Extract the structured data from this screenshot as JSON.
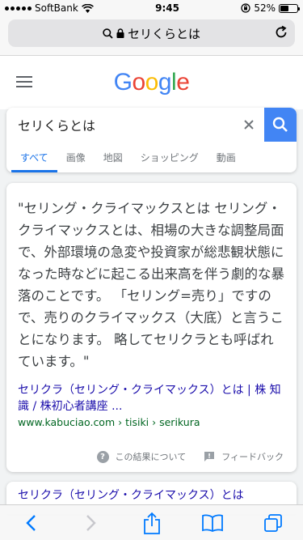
{
  "status": {
    "carrier": "SoftBank",
    "time": "9:45",
    "battery": "52%",
    "battery_level": 0.52
  },
  "urlbar": {
    "text": "セリくらとは"
  },
  "google": {
    "logo": [
      "G",
      "o",
      "o",
      "g",
      "l",
      "e"
    ],
    "logo_colors": [
      "#4285F4",
      "#EA4335",
      "#FBBC05",
      "#4285F4",
      "#34A853",
      "#EA4335"
    ]
  },
  "search": {
    "query": "セリくらとは",
    "tabs": [
      "すべて",
      "画像",
      "地図",
      "ショッピング",
      "動画"
    ]
  },
  "result": {
    "snippet": "\"セリング・クライマックスとは セリング・クライマックスとは、相場の大きな調整局面で、外部環境の急変や投資家が総悲観状態になった時などに起こる出来高を伴う劇的な暴落のことです。 「セリング=売り」ですので、売りのクライマックス（大底）と言うことになります。 略してセリクラとも呼ばれています。\"",
    "title": "セリクラ（セリング・クライマックス）とは | 株 知識 / 株初心者講座 ...",
    "url": "www.kabuciao.com › tisiki › serikura",
    "about": "この結果について",
    "feedback": "フィードバック"
  },
  "result2": {
    "title": "セリクラ（セリング・クライマックス）とは"
  },
  "colors": {
    "link": "#1a0dab",
    "url_green": "#006621",
    "accent": "#1a73e8",
    "search_button": "#4285f4",
    "ios_blue": "#007aff"
  }
}
